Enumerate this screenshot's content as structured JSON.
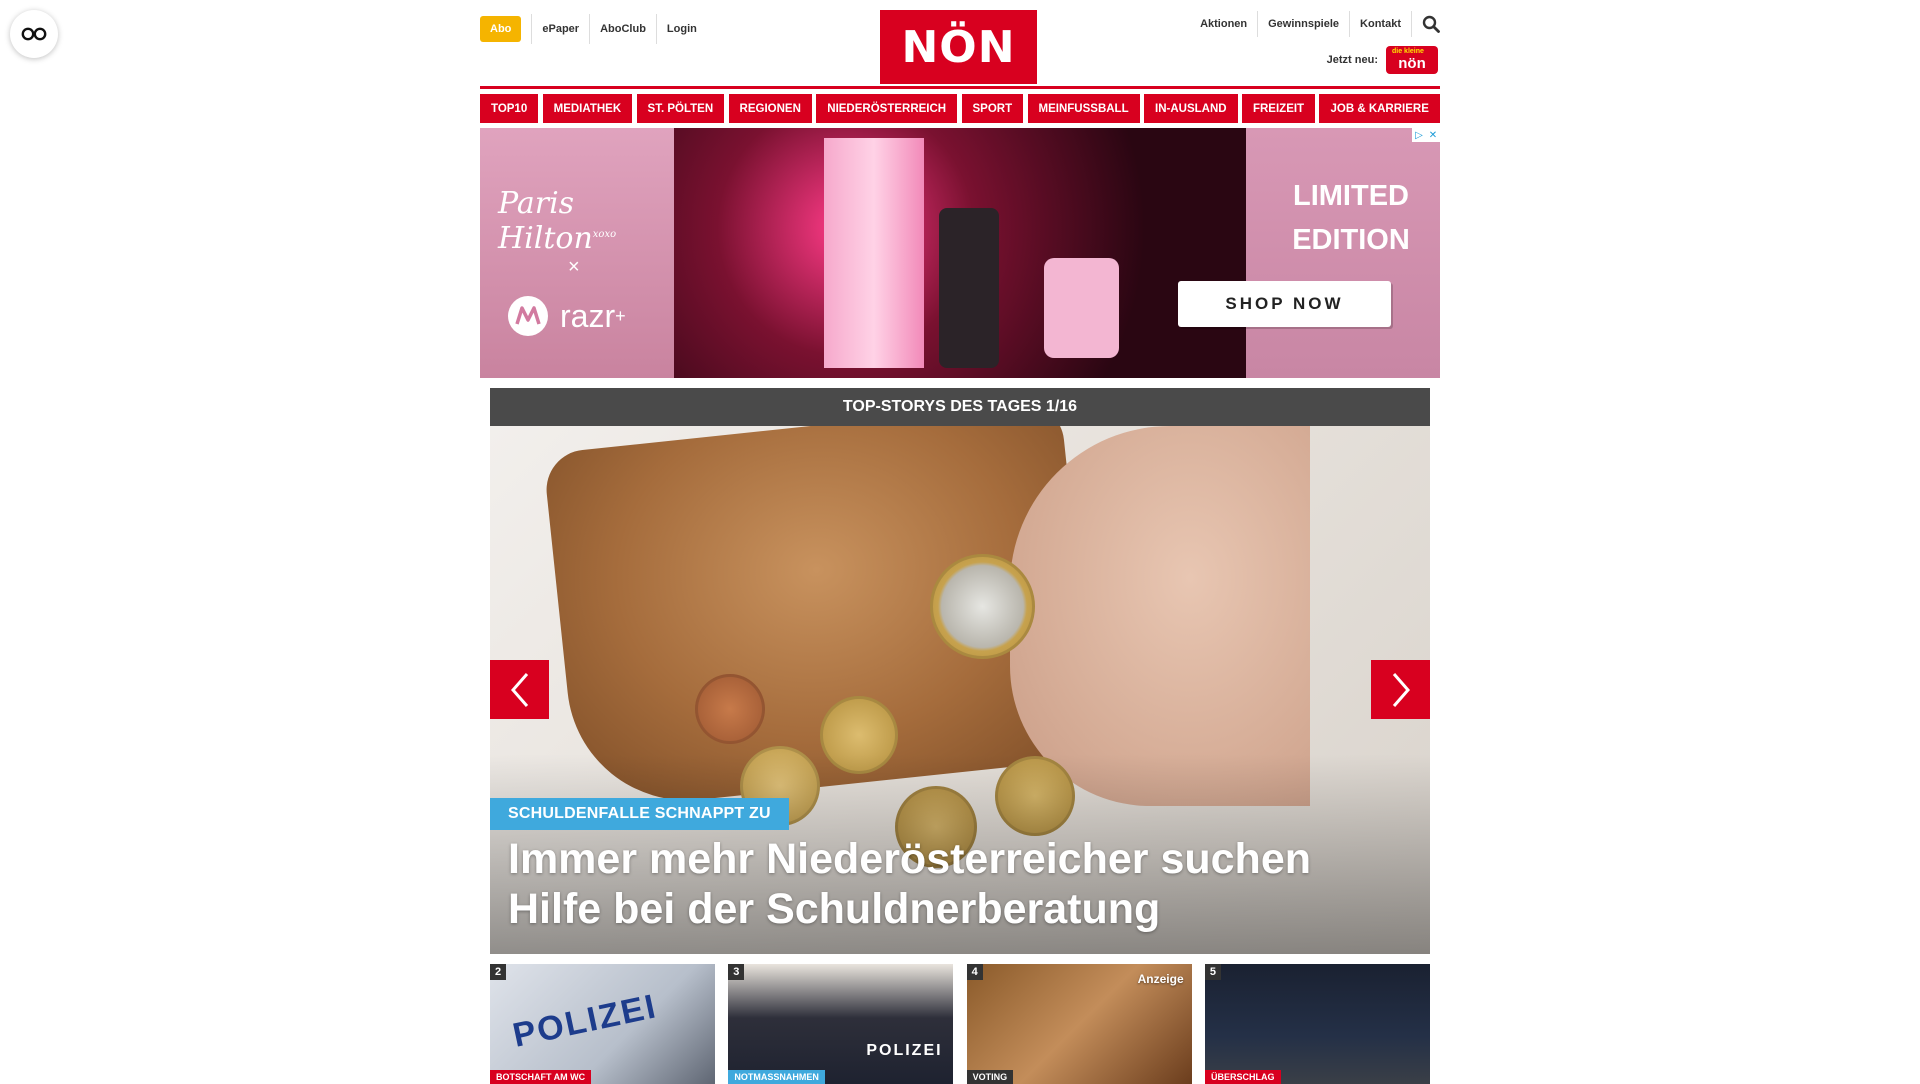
{
  "header": {
    "abo_label": "Abo",
    "left_links": [
      "ePaper",
      "AboClub",
      "Login"
    ],
    "logo_text": "NÖN",
    "right_links": [
      "Aktionen",
      "Gewinnspiele",
      "Kontakt"
    ],
    "jetzt_neu_label": "Jetzt neu:",
    "kids_logo_text": "nön",
    "kids_logo_sub": "die kleine"
  },
  "nav": {
    "items": [
      "TOP10",
      "MEDIATHEK",
      "ST. PÖLTEN",
      "REGIONEN",
      "NIEDERÖSTERREICH",
      "SPORT",
      "MEINFUSSBALL",
      "IN-AUSLAND",
      "FREIZEIT",
      "JOB & KARRIERE"
    ]
  },
  "ad": {
    "script_text": "Paris Hilton",
    "script_sub": "xoxo",
    "x_text": "×",
    "razr_text": "razr",
    "razr_plus": "+",
    "limited_line1": "LIMITED",
    "limited_line2": "EDITION",
    "shop_now": "SHOP NOW"
  },
  "stories": {
    "header": "TOP-STORYS DES TAGES 1/16",
    "hero": {
      "tag": "SCHULDENFALLE SCHNAPPT ZU",
      "title": "Immer mehr Niederösterreicher suchen Hilfe bei der Schuldnerberatung"
    },
    "thumbs": [
      {
        "num": "2",
        "tag": "BOTSCHAFT AM WC",
        "tag_color": "#d8001f",
        "image_text": "POLIZEI"
      },
      {
        "num": "3",
        "tag": "NOTMASSNAHMEN",
        "tag_color": "#3fa9dd",
        "image_text": "POLIZEI"
      },
      {
        "num": "4",
        "tag": "VOTING",
        "tag_color": "#333333",
        "ad_label": "Anzeige"
      },
      {
        "num": "5",
        "tag": "ÜBERSCHLAG",
        "tag_color": "#d8001f"
      }
    ]
  },
  "colors": {
    "brand_red": "#d8001f",
    "abo_yellow": "#f5b400",
    "tag_blue": "#3fa9dd",
    "header_gray": "#4a4a4a"
  },
  "icons": [
    "glasses-icon",
    "search-icon",
    "chevron-left-icon",
    "chevron-right-icon",
    "ad-choices-icon",
    "close-icon"
  ]
}
